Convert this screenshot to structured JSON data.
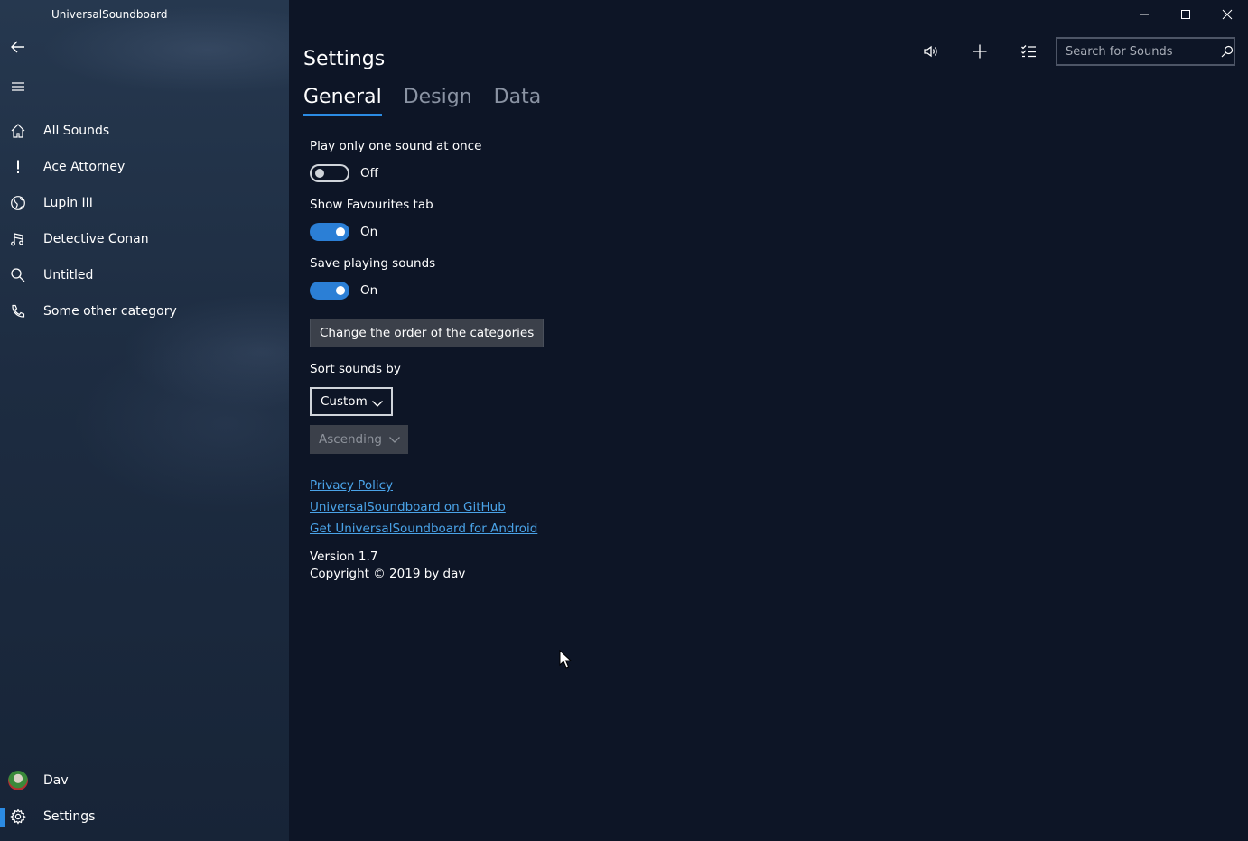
{
  "app": {
    "title": "UniversalSoundboard"
  },
  "sidebar": {
    "items": [
      {
        "label": "All Sounds",
        "icon": "home-icon"
      },
      {
        "label": "Ace Attorney",
        "icon": "exclamation-icon"
      },
      {
        "label": "Lupin III",
        "icon": "globe-icon"
      },
      {
        "label": "Detective Conan",
        "icon": "music-note-icon"
      },
      {
        "label": "Untitled",
        "icon": "search-icon"
      },
      {
        "label": "Some other category",
        "icon": "phone-icon"
      }
    ],
    "account": {
      "label": "Dav"
    },
    "settings": {
      "label": "Settings"
    }
  },
  "header": {
    "search_placeholder": "Search for Sounds"
  },
  "settings": {
    "title": "Settings",
    "tabs": [
      {
        "label": "General",
        "active": true
      },
      {
        "label": "Design",
        "active": false
      },
      {
        "label": "Data",
        "active": false
      }
    ],
    "play_one_sound": {
      "label": "Play only one sound at once",
      "state": "Off"
    },
    "show_favourites": {
      "label": "Show Favourites tab",
      "state": "On"
    },
    "save_playing": {
      "label": "Save playing sounds",
      "state": "On"
    },
    "change_order_button": "Change the order of the categories",
    "sort_by": {
      "label": "Sort sounds by",
      "value": "Custom",
      "direction": "Ascending"
    },
    "links": {
      "privacy": "Privacy Policy",
      "github": "UniversalSoundboard on GitHub",
      "android": "Get UniversalSoundboard for Android"
    },
    "version": "Version 1.7",
    "copyright": "Copyright © 2019 by dav"
  },
  "colors": {
    "accent": "#2b8be3",
    "link": "#4aa3e8",
    "background": "#0d1526"
  }
}
